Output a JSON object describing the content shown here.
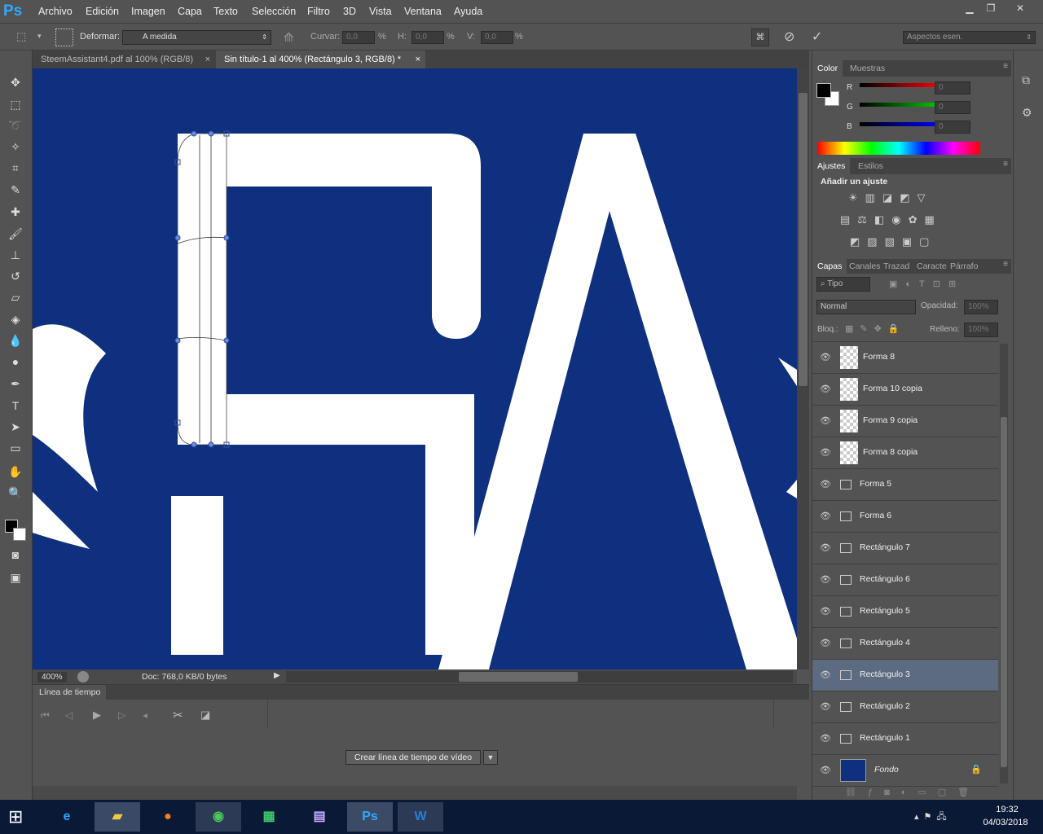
{
  "app": {
    "logo": "Ps"
  },
  "menu": [
    "Archivo",
    "Edición",
    "Imagen",
    "Capa",
    "Texto",
    "Selección",
    "Filtro",
    "3D",
    "Vista",
    "Ventana",
    "Ayuda"
  ],
  "options": {
    "warp_label": "Deformar:",
    "warp_value": "A medida",
    "bend_label": "Curvar:",
    "bend_value": "0,0",
    "bend_unit": "%",
    "h_label": "H:",
    "h_value": "0,0",
    "h_unit": "%",
    "v_label": "V:",
    "v_value": "0,0",
    "v_unit": "%",
    "workspace": "Aspectos esen."
  },
  "tabs": [
    {
      "label": "SteemAssistant4.pdf al 100% (RGB/8)",
      "active": false
    },
    {
      "label": "Sin título-1 al 400% (Rectángulo 3, RGB/8) *",
      "active": true
    }
  ],
  "status": {
    "zoom": "400%",
    "doc": "Doc: 768,0 KB/0 bytes"
  },
  "timeline": {
    "title": "Línea de tiempo",
    "create_button": "Crear línea de tiempo de vídeo"
  },
  "color_panel": {
    "tabs": [
      "Color",
      "Muestras"
    ],
    "channels": [
      {
        "label": "R",
        "value": "0",
        "color": "#ff0000"
      },
      {
        "label": "G",
        "value": "0",
        "color": "#00cc00"
      },
      {
        "label": "B",
        "value": "0",
        "color": "#0000ff"
      }
    ]
  },
  "adjust_panel": {
    "tabs": [
      "Ajustes",
      "Estilos"
    ],
    "heading": "Añadir un ajuste"
  },
  "layers_panel": {
    "tabs": [
      "Capas",
      "Canales",
      "Trazad",
      "Caracte",
      "Párrafo"
    ],
    "filter": "Tipo",
    "blend_mode": "Normal",
    "opacity_label": "Opacidad:",
    "opacity_value": "100%",
    "lock_label": "Bloq.:",
    "fill_label": "Relleno:",
    "fill_value": "100%",
    "layers": [
      {
        "name": "Forma 8",
        "kind": "smart",
        "selected": false
      },
      {
        "name": "Forma 10 copia",
        "kind": "smart",
        "selected": false
      },
      {
        "name": "Forma 9 copia",
        "kind": "smart",
        "selected": false
      },
      {
        "name": "Forma 8 copia",
        "kind": "smart",
        "selected": false
      },
      {
        "name": "Forma 5",
        "kind": "shape",
        "selected": false
      },
      {
        "name": "Forma 6",
        "kind": "shape",
        "selected": false
      },
      {
        "name": "Rectángulo 7",
        "kind": "shape",
        "selected": false
      },
      {
        "name": "Rectángulo 6",
        "kind": "shape",
        "selected": false
      },
      {
        "name": "Rectángulo 5",
        "kind": "shape",
        "selected": false
      },
      {
        "name": "Rectángulo 4",
        "kind": "shape",
        "selected": false
      },
      {
        "name": "Rectángulo 3",
        "kind": "shape",
        "selected": true
      },
      {
        "name": "Rectángulo 2",
        "kind": "shape",
        "selected": false
      },
      {
        "name": "Rectángulo 1",
        "kind": "shape",
        "selected": false
      },
      {
        "name": "Fondo",
        "kind": "background",
        "selected": false
      }
    ]
  },
  "colors": {
    "canvas": "#0f2f7f",
    "accent": "#31a8ff",
    "selected_layer": "#5c6b80"
  },
  "taskbar": {
    "apps": [
      "Internet Explorer",
      "Explorador de archivos",
      "Firefox",
      "Chrome",
      "Calculadora",
      "Calendario",
      "Photoshop",
      "Word"
    ],
    "time": "19:32",
    "date": "04/03/2018"
  }
}
